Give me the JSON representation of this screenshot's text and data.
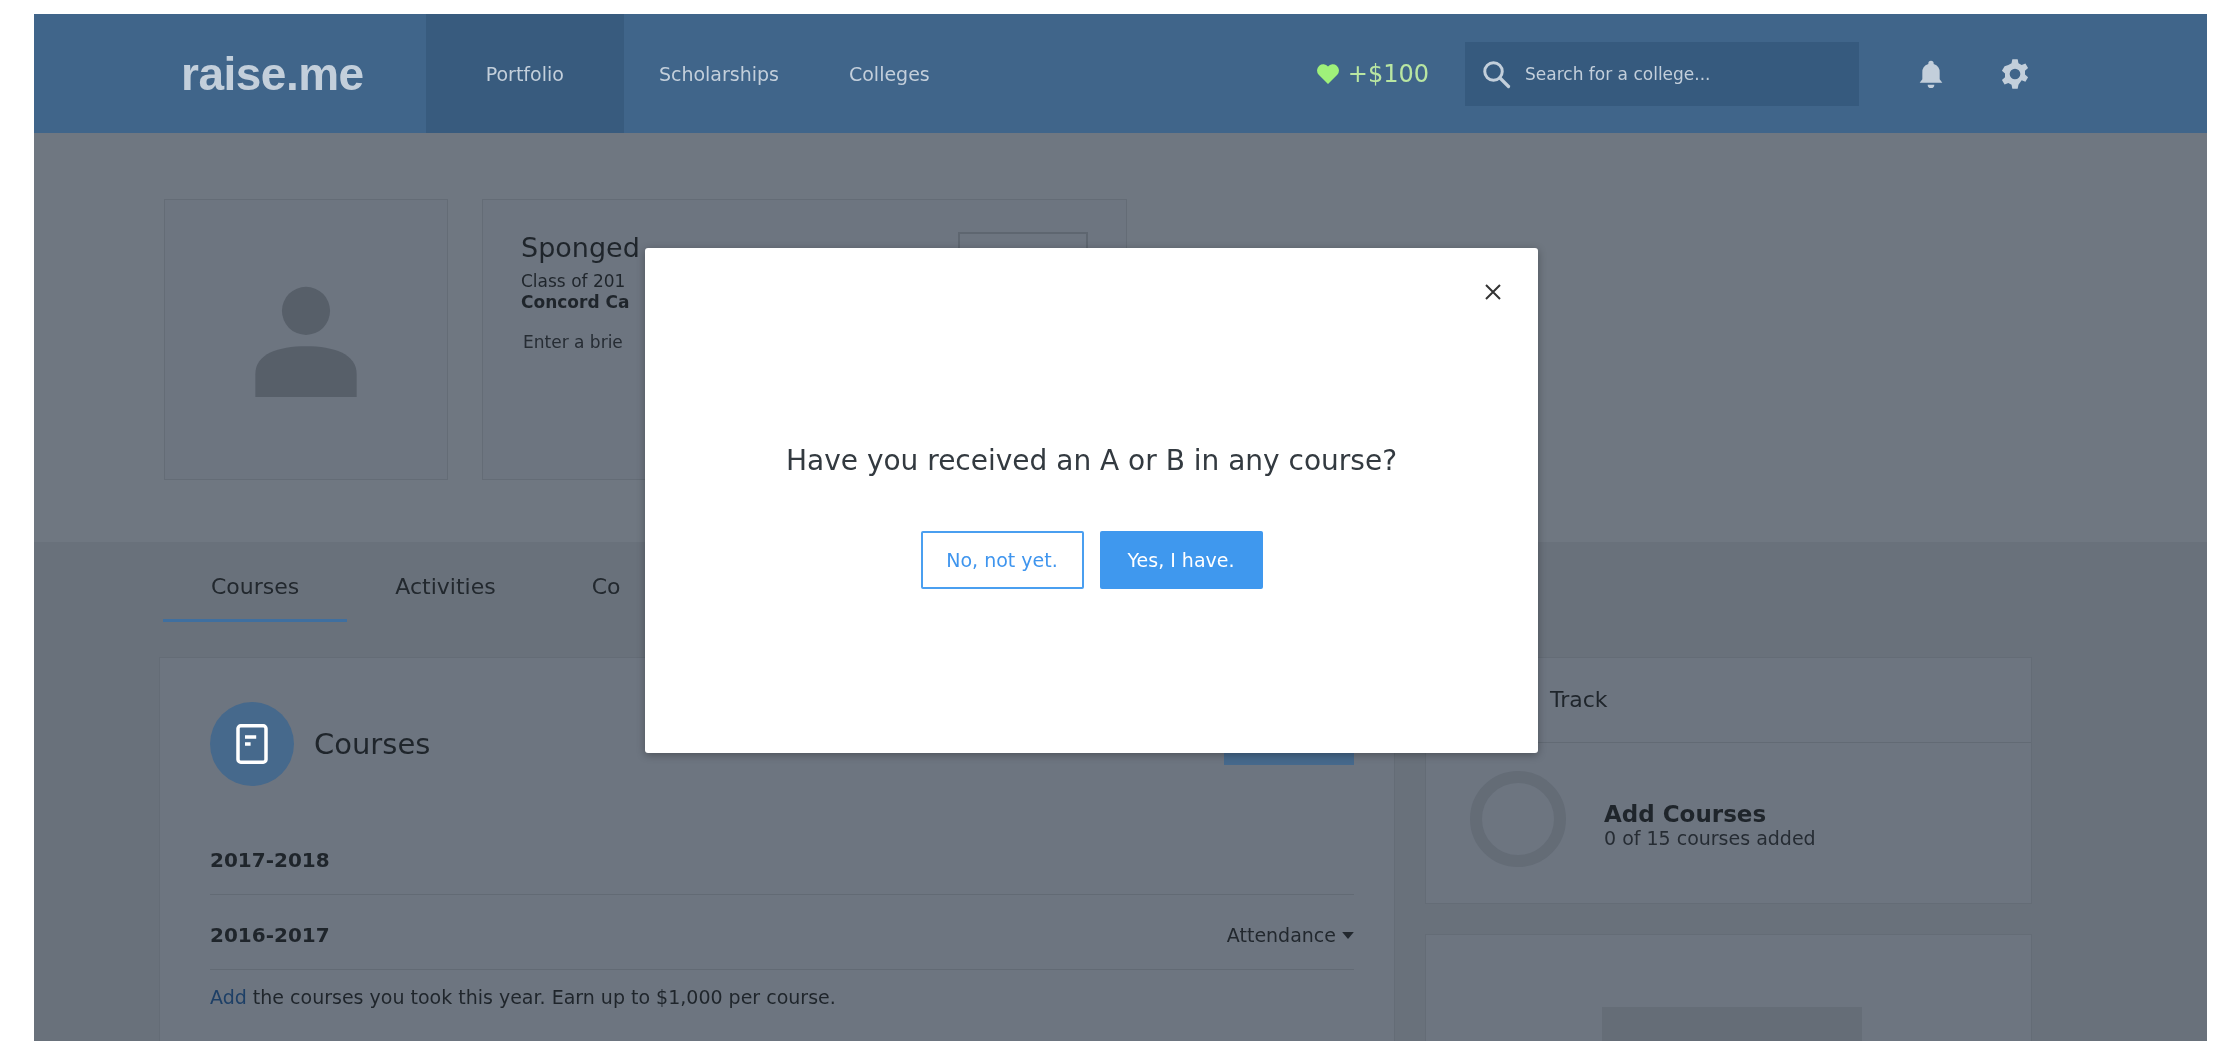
{
  "header": {
    "logo": "raise.me",
    "nav": [
      {
        "label": "Portfolio",
        "selected": true
      },
      {
        "label": "Scholarships",
        "selected": false
      },
      {
        "label": "Colleges",
        "selected": false
      }
    ],
    "earnings": "+$100",
    "search": {
      "placeholder": "Search for a college..."
    }
  },
  "profile": {
    "name": "Sponged",
    "class_year": "Class of 201",
    "school": "Concord Ca",
    "bio": {
      "placeholder": "Enter a brie"
    }
  },
  "tabs": [
    {
      "label": "Courses",
      "selected": true
    },
    {
      "label": "Activities",
      "selected": false
    },
    {
      "label": "Co",
      "selected": false
    }
  ],
  "courses": {
    "title": "Courses",
    "years": [
      {
        "label": "2017-2018"
      },
      {
        "label": "2016-2017",
        "filter": "Attendance"
      }
    ],
    "hint_link": "Add",
    "hint": "the courses you took this year. Earn up to $1,000 per course."
  },
  "track": {
    "title": "Track",
    "item": {
      "title": "Add Courses",
      "subtitle": "0 of 15 courses added"
    }
  },
  "modal": {
    "question": "Have you received an A or B in any course?",
    "buttons": [
      {
        "label": "No, not yet.",
        "kind": "secondary"
      },
      {
        "label": "Yes, I have.",
        "kind": "primary"
      }
    ]
  }
}
